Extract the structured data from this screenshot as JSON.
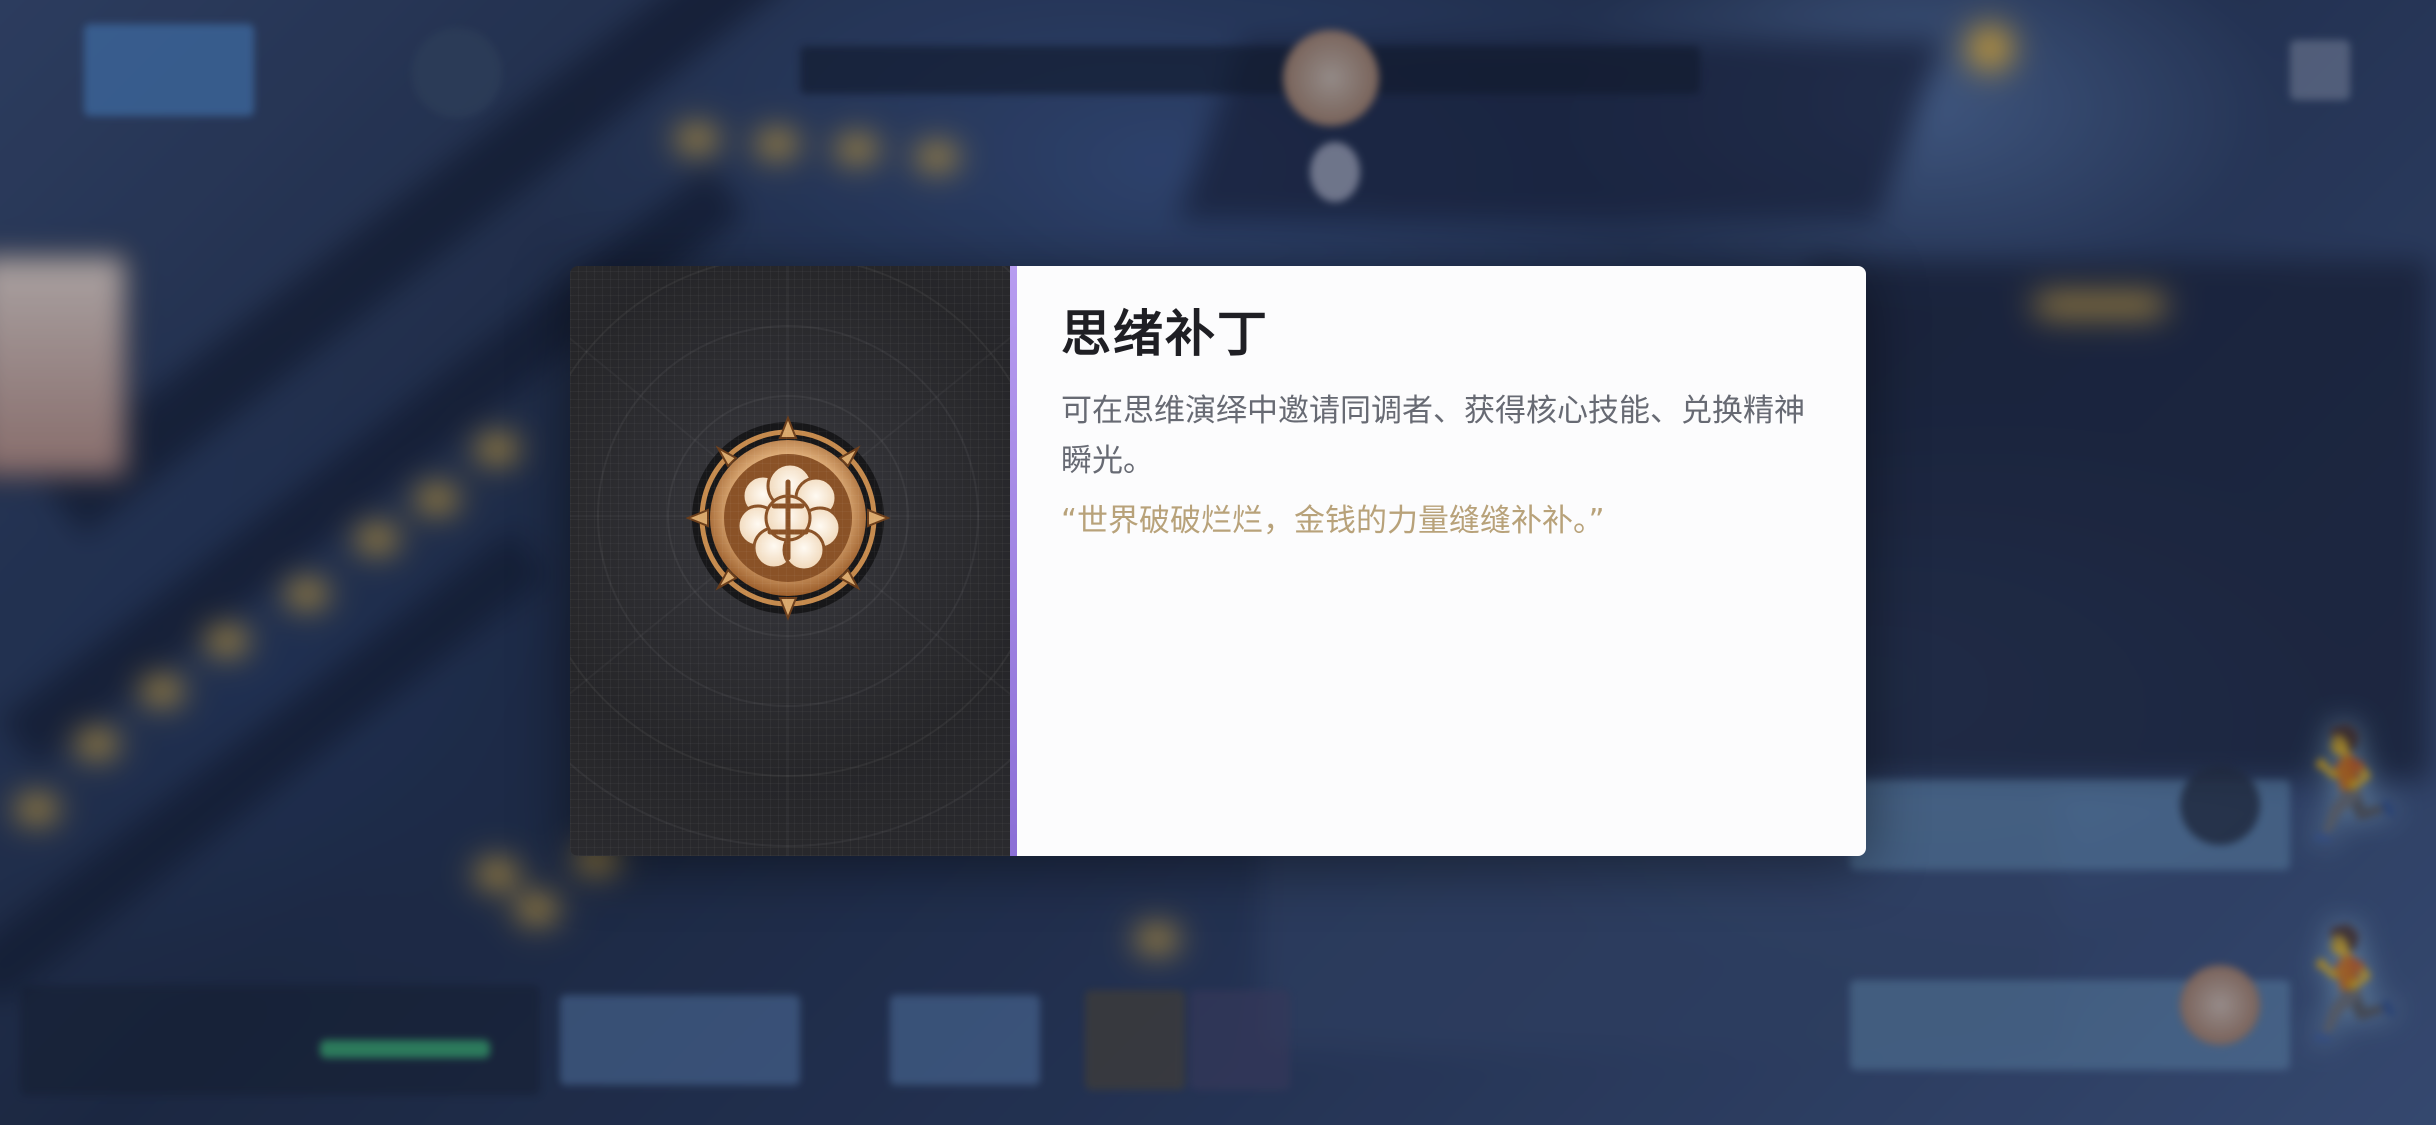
{
  "item": {
    "name": "思绪补丁",
    "description": "可在思维演绎中邀请同调者、获得核心技能、兑换精神瞬光。",
    "quote": "“世界破破烂烂，金钱的力量缝缝补补。”",
    "icon": "brain-patch-emblem-icon",
    "accent_color": "#9b7fe3",
    "quote_color": "#b8a27a"
  }
}
